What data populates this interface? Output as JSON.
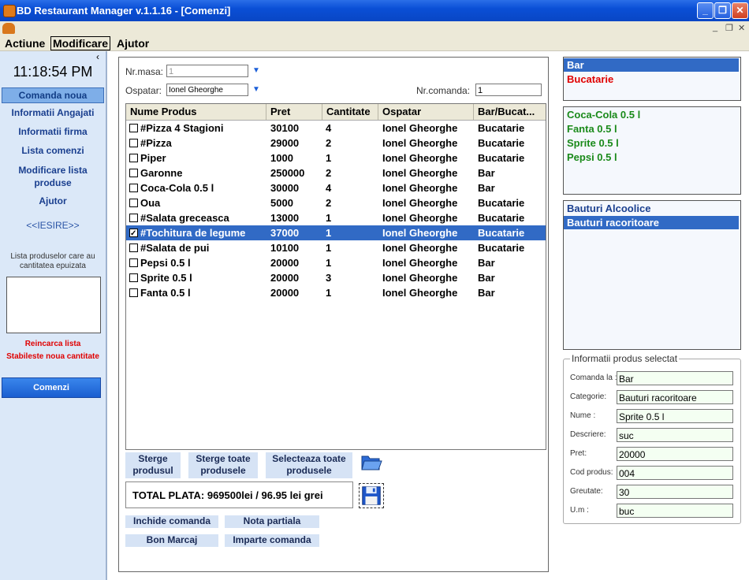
{
  "window": {
    "title": "BD Restaurant Manager v.1.1.16 - [Comenzi]"
  },
  "menu": [
    "Actiune",
    "Modificare",
    "Ajutor"
  ],
  "sidebar": {
    "time": "11:18:54 PM",
    "items": [
      "Comanda noua",
      "Informatii Angajati",
      "Informatii firma",
      "Lista comenzi",
      "Modificare lista produse",
      "Ajutor"
    ],
    "exit": "<<IESIRE>>",
    "depleted_label": "Lista produselor care au cantitatea epuizata",
    "reload": "Reincarca lista",
    "set_qty": "Stabileste noua cantitate",
    "orders_button": "Comenzi"
  },
  "order": {
    "table_label": "Nr.masa:",
    "table_value": "1",
    "waiter_label": "Ospatar:",
    "waiter_value": "Ionel Gheorghe",
    "order_no_label": "Nr.comanda:",
    "order_no_value": "1"
  },
  "table": {
    "headers": [
      "Nume Produs",
      "Pret",
      "Cantitate",
      "Ospatar",
      "Bar/Bucat..."
    ],
    "rows": [
      {
        "name": "#Pizza 4 Stagioni",
        "price": "30100",
        "qty": "4",
        "waiter": "Ionel Gheorghe",
        "dest": "Bucatarie",
        "checked": false
      },
      {
        "name": "#Pizza",
        "price": "29000",
        "qty": "2",
        "waiter": "Ionel Gheorghe",
        "dest": "Bucatarie",
        "checked": false
      },
      {
        "name": "Piper",
        "price": "1000",
        "qty": "1",
        "waiter": "Ionel Gheorghe",
        "dest": "Bucatarie",
        "checked": false
      },
      {
        "name": "Garonne",
        "price": "250000",
        "qty": "2",
        "waiter": "Ionel Gheorghe",
        "dest": "Bar",
        "checked": false
      },
      {
        "name": "Coca-Cola 0.5 l",
        "price": "30000",
        "qty": "4",
        "waiter": "Ionel Gheorghe",
        "dest": "Bar",
        "checked": false
      },
      {
        "name": "Oua",
        "price": "5000",
        "qty": "2",
        "waiter": "Ionel Gheorghe",
        "dest": "Bucatarie",
        "checked": false
      },
      {
        "name": "#Salata greceasca",
        "price": "13000",
        "qty": "1",
        "waiter": "Ionel Gheorghe",
        "dest": "Bucatarie",
        "checked": false
      },
      {
        "name": "#Tochitura de legume",
        "price": "37000",
        "qty": "1",
        "waiter": "Ionel Gheorghe",
        "dest": "Bucatarie",
        "checked": true,
        "selected": true
      },
      {
        "name": "#Salata de pui",
        "price": "10100",
        "qty": "1",
        "waiter": "Ionel Gheorghe",
        "dest": "Bucatarie",
        "checked": false
      },
      {
        "name": "Pepsi 0.5 l",
        "price": "20000",
        "qty": "1",
        "waiter": "Ionel Gheorghe",
        "dest": "Bar",
        "checked": false
      },
      {
        "name": "Sprite 0.5 l",
        "price": "20000",
        "qty": "3",
        "waiter": "Ionel Gheorghe",
        "dest": "Bar",
        "checked": false
      },
      {
        "name": "Fanta 0.5 l",
        "price": "20000",
        "qty": "1",
        "waiter": "Ionel Gheorghe",
        "dest": "Bar",
        "checked": false
      }
    ]
  },
  "actions": {
    "delete_product": "Sterge produsul",
    "delete_all": "Sterge toate produsele",
    "select_all": "Selecteaza toate produsele",
    "total": "TOTAL PLATA: 969500lei / 96.95 lei grei",
    "close_order": "Inchide comanda",
    "partial_note": "Nota partiala",
    "bon_marcaj": "Bon Marcaj",
    "split_order": "Imparte comanda"
  },
  "right": {
    "locations": [
      {
        "label": "Bar",
        "color": "#ffffff",
        "selected": true
      },
      {
        "label": "Bucatarie",
        "color": "#e00000",
        "selected": false
      }
    ],
    "products": [
      "Coca-Cola 0.5 l",
      "Fanta 0.5 l",
      "Sprite 0.5 l",
      "Pepsi 0.5 l"
    ],
    "products_color": "#1a8a1a",
    "categories": [
      {
        "label": "Bauturi Alcoolice",
        "selected": false
      },
      {
        "label": "Bauturi racoritoare",
        "selected": true
      }
    ],
    "info_title": "Informatii produs selectat",
    "info": [
      {
        "label": "Comanda la :",
        "value": "Bar"
      },
      {
        "label": "Categorie:",
        "value": "Bauturi racoritoare"
      },
      {
        "label": "Nume :",
        "value": "Sprite 0.5 l"
      },
      {
        "label": "Descriere:",
        "value": "suc"
      },
      {
        "label": "Pret:",
        "value": "20000"
      },
      {
        "label": "Cod produs:",
        "value": "004"
      },
      {
        "label": "Greutate:",
        "value": "30"
      },
      {
        "label": "U.m :",
        "value": "buc"
      }
    ]
  }
}
